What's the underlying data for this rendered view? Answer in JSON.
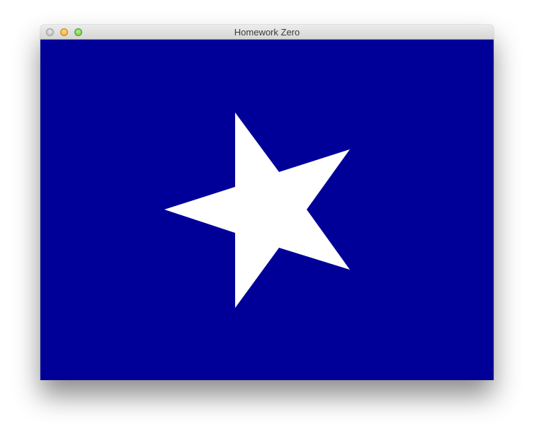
{
  "window": {
    "title": "Homework Zero",
    "controls": [
      "close-icon",
      "minimize-icon",
      "zoom-icon"
    ]
  },
  "canvas": {
    "background_color": "#000099",
    "shape": "star",
    "shape_color": "#ffffff"
  }
}
